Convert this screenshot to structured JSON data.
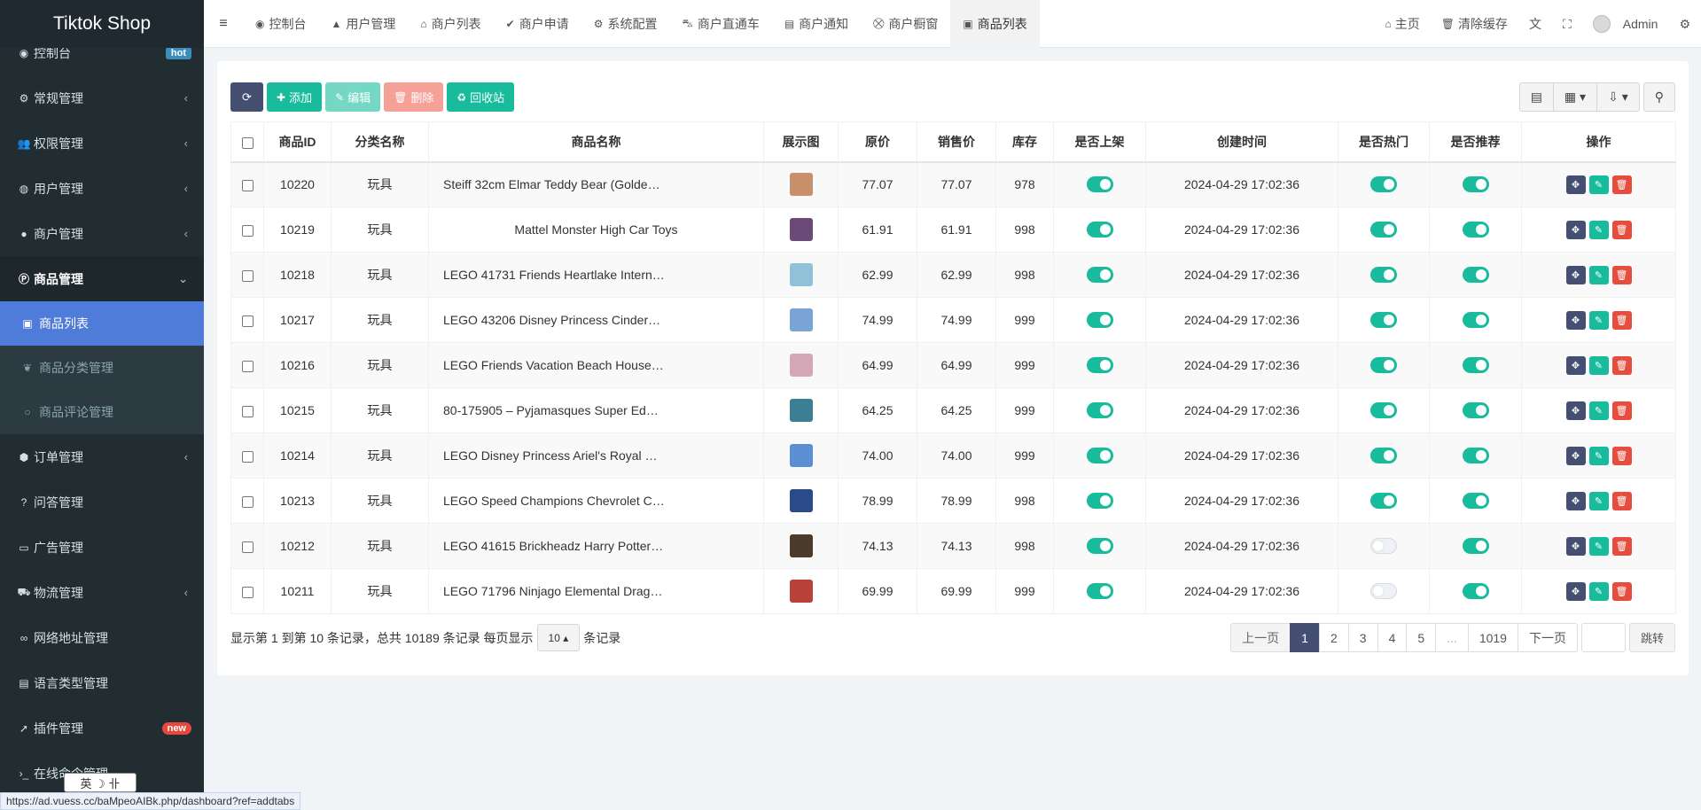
{
  "app": {
    "brand": "Tiktok Shop"
  },
  "sidebar": {
    "items": [
      {
        "label": "控制台",
        "icon": "dashboard-icon",
        "glyph": "◉",
        "badge": "hot"
      },
      {
        "label": "常规管理",
        "icon": "cogs-icon",
        "glyph": "⚙",
        "arrow": "‹"
      },
      {
        "label": "权限管理",
        "icon": "group-icon",
        "glyph": "👥",
        "arrow": "‹"
      },
      {
        "label": "用户管理",
        "icon": "user-circle-icon",
        "glyph": "◍",
        "arrow": "‹"
      },
      {
        "label": "商户管理",
        "icon": "apple-icon",
        "glyph": "●",
        "arrow": "‹"
      },
      {
        "label": "商品管理",
        "icon": "product-hunt-icon",
        "glyph": "Ⓟ",
        "arrow": "⌄"
      }
    ],
    "sub_items": [
      {
        "label": "商品列表",
        "icon": "shopping-bag-icon",
        "glyph": "▣"
      },
      {
        "label": "商品分类管理",
        "icon": "leaf-icon",
        "glyph": "❦"
      },
      {
        "label": "商品评论管理",
        "icon": "circle-icon",
        "glyph": "○"
      }
    ],
    "items_after": [
      {
        "label": "订单管理",
        "icon": "cube-icon",
        "glyph": "⬢",
        "arrow": "‹"
      },
      {
        "label": "问答管理",
        "icon": "question-circle-icon",
        "glyph": "?"
      },
      {
        "label": "广告管理",
        "icon": "credit-card-icon",
        "glyph": "▭"
      },
      {
        "label": "物流管理",
        "icon": "truck-icon",
        "glyph": "⛟",
        "arrow": "‹"
      },
      {
        "label": "网络地址管理",
        "icon": "link-icon",
        "glyph": "∞"
      },
      {
        "label": "语言类型管理",
        "icon": "language-icon",
        "glyph": "▤"
      },
      {
        "label": "插件管理",
        "icon": "rocket-icon",
        "glyph": "➚",
        "badge": "new"
      },
      {
        "label": "在线命令管理",
        "icon": "terminal-icon",
        "glyph": "›_"
      }
    ]
  },
  "ime": {
    "text": "英 ☽ 卝"
  },
  "topnav": {
    "tabs": [
      {
        "label": "控制台",
        "icon": "dashboard-icon",
        "glyph": "◉"
      },
      {
        "label": "用户管理",
        "icon": "user-icon",
        "glyph": "▲"
      },
      {
        "label": "商户列表",
        "icon": "home-icon",
        "glyph": "⌂"
      },
      {
        "label": "商户申请",
        "icon": "check-circle-icon",
        "glyph": "✔"
      },
      {
        "label": "系统配置",
        "icon": "cog-icon",
        "glyph": "⚙"
      },
      {
        "label": "商户直通车",
        "icon": "car-icon",
        "glyph": "⛍"
      },
      {
        "label": "商户通知",
        "icon": "list-alt-icon",
        "glyph": "▤"
      },
      {
        "label": "商户橱窗",
        "icon": "shopping-cart-icon",
        "glyph": "⛒"
      },
      {
        "label": "商品列表",
        "icon": "shopping-bag-icon",
        "glyph": "▣",
        "active": true
      }
    ],
    "right": {
      "home": "主页",
      "clear_cache": "清除缓存",
      "user": "Admin"
    }
  },
  "toolbar": {
    "add": "添加",
    "edit": "编辑",
    "delete": "删除",
    "recycle": "回收站"
  },
  "table": {
    "headers": [
      "商品ID",
      "分类名称",
      "商品名称",
      "展示图",
      "原价",
      "销售价",
      "库存",
      "是否上架",
      "创建时间",
      "是否热门",
      "是否推荐",
      "操作"
    ],
    "rows": [
      {
        "id": "10220",
        "category": "玩具",
        "name": "Steiff 32cm Elmar Teddy Bear (Golde…",
        "thumb": "#c98f6b",
        "price": "77.07",
        "sale": "77.07",
        "stock": "978",
        "on_sale": true,
        "created": "2024-04-29 17:02:36",
        "hot": true,
        "recommend": true
      },
      {
        "id": "10219",
        "category": "玩具",
        "name": "Mattel Monster High Car Toys",
        "thumb": "#6b4a7a",
        "price": "61.91",
        "sale": "61.91",
        "stock": "998",
        "on_sale": true,
        "created": "2024-04-29 17:02:36",
        "hot": true,
        "recommend": true,
        "center": true
      },
      {
        "id": "10218",
        "category": "玩具",
        "name": "LEGO 41731 Friends Heartlake Intern…",
        "thumb": "#8fc1d8",
        "price": "62.99",
        "sale": "62.99",
        "stock": "998",
        "on_sale": true,
        "created": "2024-04-29 17:02:36",
        "hot": true,
        "recommend": true
      },
      {
        "id": "10217",
        "category": "玩具",
        "name": "LEGO 43206 Disney Princess Cinder…",
        "thumb": "#7aa3d6",
        "price": "74.99",
        "sale": "74.99",
        "stock": "999",
        "on_sale": true,
        "created": "2024-04-29 17:02:36",
        "hot": true,
        "recommend": true
      },
      {
        "id": "10216",
        "category": "玩具",
        "name": "LEGO Friends Vacation Beach House…",
        "thumb": "#d4a8b7",
        "price": "64.99",
        "sale": "64.99",
        "stock": "999",
        "on_sale": true,
        "created": "2024-04-29 17:02:36",
        "hot": true,
        "recommend": true
      },
      {
        "id": "10215",
        "category": "玩具",
        "name": "80-175905 – Pyjamasques Super Ed…",
        "thumb": "#3a7f93",
        "price": "64.25",
        "sale": "64.25",
        "stock": "999",
        "on_sale": true,
        "created": "2024-04-29 17:02:36",
        "hot": true,
        "recommend": true
      },
      {
        "id": "10214",
        "category": "玩具",
        "name": "LEGO Disney Princess Ariel's Royal …",
        "thumb": "#5b8fd1",
        "price": "74.00",
        "sale": "74.00",
        "stock": "999",
        "on_sale": true,
        "created": "2024-04-29 17:02:36",
        "hot": true,
        "recommend": true
      },
      {
        "id": "10213",
        "category": "玩具",
        "name": "LEGO Speed Champions Chevrolet C…",
        "thumb": "#2b4a8a",
        "price": "78.99",
        "sale": "78.99",
        "stock": "998",
        "on_sale": true,
        "created": "2024-04-29 17:02:36",
        "hot": true,
        "recommend": true
      },
      {
        "id": "10212",
        "category": "玩具",
        "name": "LEGO 41615 Brickheadz Harry Potter…",
        "thumb": "#4a3b2c",
        "price": "74.13",
        "sale": "74.13",
        "stock": "998",
        "on_sale": true,
        "created": "2024-04-29 17:02:36",
        "hot": false,
        "recommend": true
      },
      {
        "id": "10211",
        "category": "玩具",
        "name": "LEGO 71796 Ninjago Elemental Drag…",
        "thumb": "#b8423a",
        "price": "69.99",
        "sale": "69.99",
        "stock": "999",
        "on_sale": true,
        "created": "2024-04-29 17:02:36",
        "hot": false,
        "recommend": true
      }
    ]
  },
  "pagination": {
    "info_prefix": "显示第 1 到第 10 条记录，总共 10189 条记录 每页显示",
    "page_size": "10",
    "info_suffix": "条记录",
    "prev": "上一页",
    "pages": [
      "1",
      "2",
      "3",
      "4",
      "5",
      "...",
      "1019"
    ],
    "next": "下一页",
    "jump": "跳转"
  },
  "statusbar": {
    "url": "https://ad.vuess.cc/baMpeoAIBk.php/dashboard?ref=addtabs"
  }
}
